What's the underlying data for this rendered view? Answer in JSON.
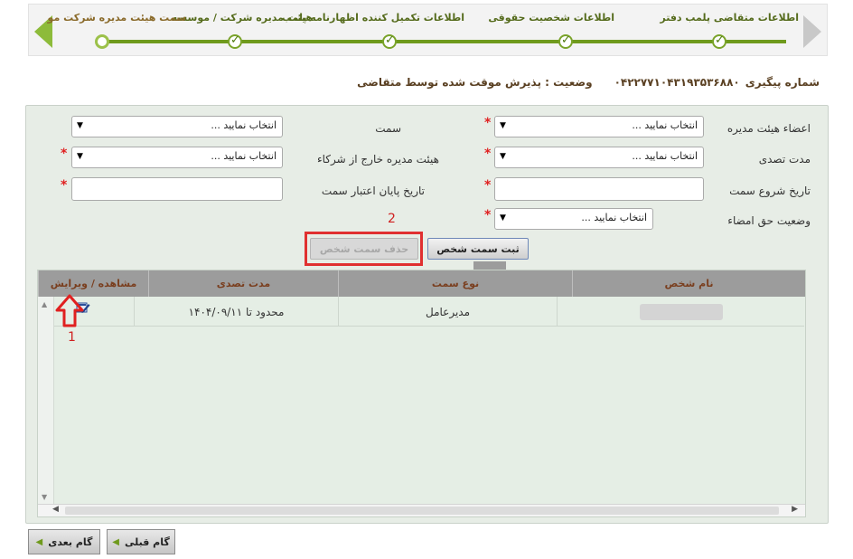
{
  "stepper": {
    "steps": [
      {
        "label": "اطلاعات متقاضی پلمب دفتر",
        "state": "done"
      },
      {
        "label": "اطلاعات شخصیت حقوقی",
        "state": "done"
      },
      {
        "label": "اطلاعات تکمیل کننده اظهارنامه پلمب",
        "state": "done"
      },
      {
        "label": "هیئت مدیره شرکت / موسسه",
        "state": "done"
      },
      {
        "label": "سمت هیئت مدیره شرکت مو",
        "state": "current"
      }
    ]
  },
  "tracking": {
    "label": "شماره پیگیری",
    "number": "۰۴۲۲۷۷۱۰۴۳۱۹۳۵۳۶۸۸۰",
    "status": "وضعیت : پذیرش موقت شده توسط متقاضی"
  },
  "form": {
    "board_members_label": "اعضاء هیئت مدیره",
    "board_members_value": "انتخاب نمایید ...",
    "position_label": "سمت",
    "position_value": "انتخاب نمایید ...",
    "tenure_label": "مدت تصدی",
    "tenure_value": "انتخاب نمایید ...",
    "external_board_label": "هیئت مدیره خارج از شرکاء",
    "external_board_value": "انتخاب نمایید ...",
    "start_date_label": "تاریخ شروع سمت",
    "end_date_label": "تاریخ پایان اعتبار سمت",
    "signature_label": "وضعیت حق امضاء",
    "signature_value": "انتخاب نمایید ...",
    "required_mark": "*",
    "register_button": "ثبت سمت شخص",
    "delete_button": "حذف سمت شخص",
    "annotation_2": "2"
  },
  "grid": {
    "columns": [
      "نام شخص",
      "نوع سمت",
      "مدت تصدی",
      "مشاهده / ویرایش"
    ],
    "rows": [
      {
        "name": "",
        "position_type": "مدیرعامل",
        "tenure": "محدود تا ۱۴۰۴/۰۹/۱۱"
      }
    ],
    "annotation_1": "1"
  },
  "nav": {
    "prev_label": "گام قبلی",
    "next_label": "گام بعدی"
  },
  "colors": {
    "accent_green": "#6f9a1d",
    "annotation_red": "#e03030",
    "header_text_brown": "#7a3f1f"
  }
}
